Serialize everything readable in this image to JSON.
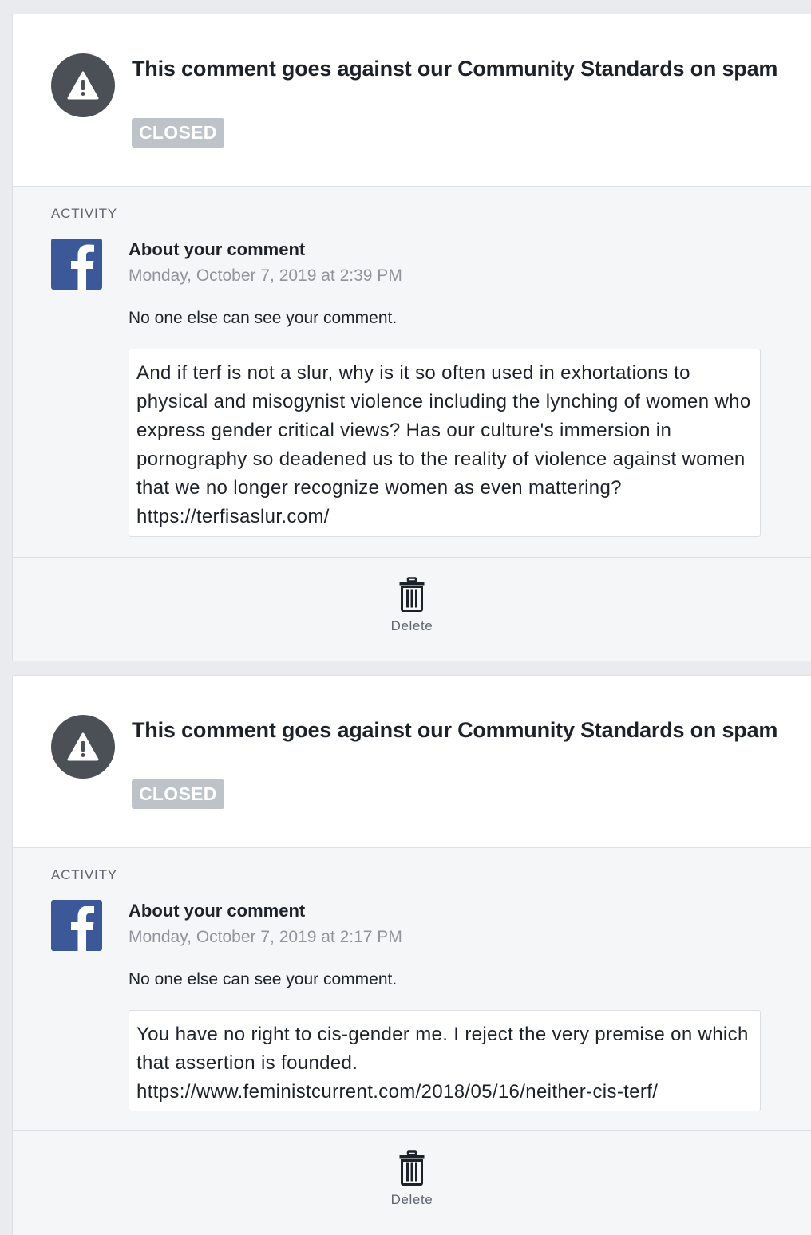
{
  "reports": [
    {
      "header": {
        "title": "This comment goes against our Community Standards on spam",
        "status": "CLOSED",
        "icon": "warning-icon"
      },
      "activity": {
        "section_label": "ACTIVITY",
        "icon": "facebook-logo-icon",
        "title": "About your comment",
        "date": "Monday, October 7, 2019 at 2:39 PM",
        "note": "No one else can see your comment.",
        "comment": "And if terf is not a slur, why is it so often used in exhortations to physical and misogynist violence including the lynching of women who express gender critical views? Has our culture's immersion in pornography so deadened us to the reality of violence against women that we no longer recognize women as even mattering? https://terfisaslur.com/"
      },
      "actions": {
        "delete_label": "Delete",
        "delete_icon": "trash-icon"
      }
    },
    {
      "header": {
        "title": "This comment goes against our Community Standards on spam",
        "status": "CLOSED",
        "icon": "warning-icon"
      },
      "activity": {
        "section_label": "ACTIVITY",
        "icon": "facebook-logo-icon",
        "title": "About your comment",
        "date": "Monday, October 7, 2019 at 2:17 PM",
        "note": "No one else can see your comment.",
        "comment": "You have no right to cis-gender me. I reject the very premise on which that assertion is founded. https://www.feministcurrent.com/2018/05/16/neither-cis-terf/"
      },
      "actions": {
        "delete_label": "Delete",
        "delete_icon": "trash-icon"
      }
    }
  ],
  "colors": {
    "page_background": "#e9ebee",
    "card_background": "#ffffff",
    "activity_background": "#f5f6f7",
    "warning_circle": "#4b4f56",
    "badge_background": "#bec3c9",
    "facebook_blue": "#3b5998",
    "secondary_text": "#90949c"
  }
}
